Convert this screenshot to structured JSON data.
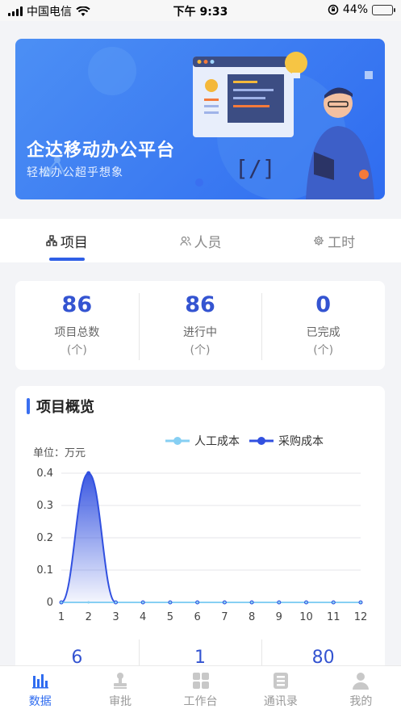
{
  "status_bar": {
    "carrier": "中国电信",
    "time": "下午 9:33",
    "battery": "44%",
    "battery_level": 0.44
  },
  "banner": {
    "title": "企达移动办公平台",
    "subtitle": "轻松办公超乎想象"
  },
  "tabs": [
    {
      "label": "项目",
      "icon": "project-icon",
      "active": true
    },
    {
      "label": "人员",
      "icon": "people-icon",
      "active": false
    },
    {
      "label": "工时",
      "icon": "gear-icon",
      "active": false
    }
  ],
  "stats": [
    {
      "value": "86",
      "label": "项目总数",
      "unit": "(个)"
    },
    {
      "value": "86",
      "label": "进行中",
      "unit": "(个)"
    },
    {
      "value": "0",
      "label": "已完成",
      "unit": "(个)"
    }
  ],
  "overview": {
    "title": "项目概览",
    "unit_label": "单位：万元"
  },
  "chart_data": {
    "type": "area",
    "x": [
      1,
      2,
      3,
      4,
      5,
      6,
      7,
      8,
      9,
      10,
      11,
      12
    ],
    "ylim": [
      0,
      0.4
    ],
    "yticks": [
      "0",
      "0.1",
      "0.2",
      "0.3",
      "0.4"
    ],
    "grid": true,
    "legend_position": "top-right",
    "series": [
      {
        "name": "人工成本",
        "color": "#86cff3",
        "values": [
          0,
          0,
          0,
          0,
          0,
          0,
          0,
          0,
          0,
          0,
          0,
          0
        ]
      },
      {
        "name": "采购成本",
        "color": "#3150e0",
        "values": [
          0,
          0.4,
          0,
          0,
          0,
          0,
          0,
          0,
          0,
          0,
          0,
          0
        ]
      }
    ]
  },
  "bottom_stats": [
    "6",
    "1",
    "80"
  ],
  "nav": [
    {
      "label": "数据",
      "icon": "chart-bar-icon",
      "active": true
    },
    {
      "label": "审批",
      "icon": "stamp-icon",
      "active": false
    },
    {
      "label": "工作台",
      "icon": "grid-icon",
      "active": false
    },
    {
      "label": "通讯录",
      "icon": "contacts-icon",
      "active": false
    },
    {
      "label": "我的",
      "icon": "user-icon",
      "active": false
    }
  ]
}
